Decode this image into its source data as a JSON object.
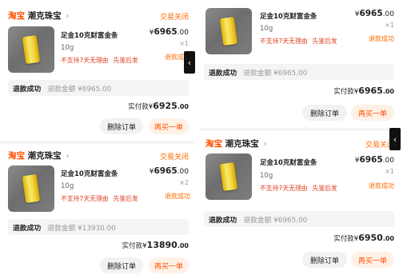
{
  "common": {
    "taobao": "淘宝",
    "store": "潮克珠宝",
    "chevron": "›",
    "status": "交易关闭",
    "product_name": "足金10克财富金条",
    "spec": "10g",
    "tag1": "不支持7天无理由",
    "tag2": "先鉴后发",
    "refund_tag": "退款成功",
    "refund_status": "退款成功",
    "paid_label": "实付款",
    "delete_label": "删除订单",
    "rebuy_label": "再买一单",
    "currency": "¥"
  },
  "orders": [
    {
      "price_int": "6965",
      "price_dec": ".00",
      "qty": "×1",
      "refund_amount": "退款金额 ¥6965.00",
      "total_int": "6925",
      "total_dec": ".00"
    },
    {
      "price_int": "6965",
      "price_dec": ".00",
      "qty": "×2",
      "refund_amount": "退款金额 ¥13930.00",
      "total_int": "13890",
      "total_dec": ".00"
    },
    {
      "price_int": "6965",
      "price_dec": ".00",
      "qty": "×1",
      "refund_amount": "退款金额 ¥6965.00",
      "total_int": "6965",
      "total_dec": ".00"
    },
    {
      "price_int": "6965",
      "price_dec": ".00",
      "qty": "×1",
      "refund_amount": "退款金额 ¥6965.00",
      "total_int": "6950",
      "total_dec": ".00"
    }
  ],
  "side_tab_icon": "chevron-left-icon",
  "colors": {
    "accent": "#ff5000",
    "status": "#ff6a00",
    "tag": "#e0401f",
    "refund_bg": "#f4f4f4"
  }
}
